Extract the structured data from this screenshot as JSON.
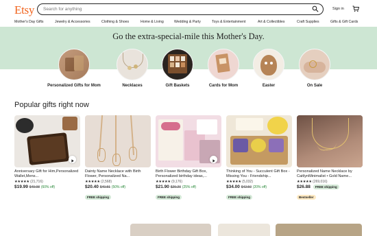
{
  "header": {
    "logo": "Etsy",
    "search_placeholder": "Search for anything",
    "signin_label": "Sign in"
  },
  "nav": {
    "items": [
      "Mother's Day Gifts",
      "Jewelry & Accessories",
      "Clothing & Shoes",
      "Home & Living",
      "Wedding & Party",
      "Toys & Entertainment",
      "Art & Collectibles",
      "Craft Supplies",
      "Gifts & Gift Cards"
    ]
  },
  "hero": {
    "title": "Go the extra-special-mile this Mother's Day.",
    "categories": [
      {
        "label": "Personalized Gifts for Mom"
      },
      {
        "label": "Necklaces"
      },
      {
        "label": "Gift Baskets"
      },
      {
        "label": "Cards for Mom"
      },
      {
        "label": "Easter"
      },
      {
        "label": "On Sale"
      }
    ]
  },
  "popular": {
    "title": "Popular gifts right now",
    "items": [
      {
        "title": "Anniversary Gift for Him,Personalized Wallet,Mens...",
        "stars": "★★★★★",
        "count": "(21,716)",
        "price": "$19.99",
        "orig": "$49.98",
        "off": "(60% off)",
        "badge": ""
      },
      {
        "title": "Dainty Name Necklace with Birth Flower, Personalized Na...",
        "stars": "★★★★★",
        "count": "(2,568)",
        "price": "$20.40",
        "orig": "$40.81",
        "off": "(50% off)",
        "badge": "FREE shipping"
      },
      {
        "title": "Birth Flower Birthday Gift Box, Personalized birthday ideas,...",
        "stars": "★★★★★",
        "count": "(9,176)",
        "price": "$21.90",
        "orig": "$29.20",
        "off": "(25% off)",
        "badge": "FREE shipping"
      },
      {
        "title": "Thinking of You - Succulent Gift Box - Missing You - Friendship...",
        "stars": "★★★★★",
        "count": "(5,032)",
        "price": "$34.00",
        "orig": "$42.50",
        "off": "(20% off)",
        "badge": "FREE shipping"
      },
      {
        "title": "Personalized Name Necklace by CaitlynMinimalist • Gold Name...",
        "stars": "★★★★★",
        "count": "(269,016)",
        "price": "$26.88",
        "orig": "",
        "off": "",
        "badge": "FREE shipping",
        "badge2": "Bestseller"
      }
    ]
  },
  "colors": {
    "brand": "#f1641e",
    "hero_bg": "#cde6d3",
    "discount": "#258635",
    "free_shipping_bg": "#d4e9d7"
  },
  "icons": [
    "search-icon",
    "cart-icon",
    "play-icon",
    "star-icon"
  ]
}
